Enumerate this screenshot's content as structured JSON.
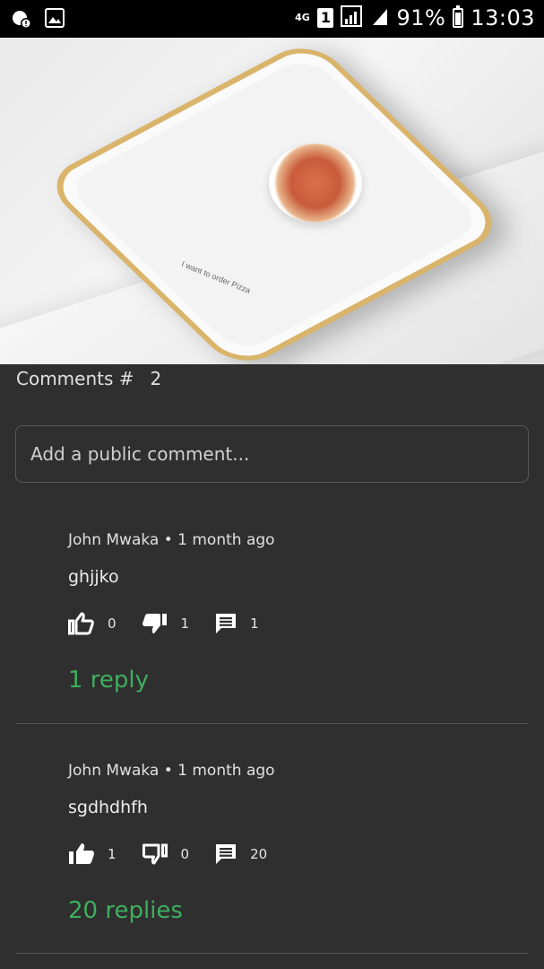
{
  "status_bar": {
    "network": "4G",
    "sim": "1",
    "battery": "91%",
    "battery_level": 0.91,
    "time": "13:03"
  },
  "hero": {
    "phone_screen_text": "I want to order Pizza"
  },
  "comments": {
    "header_label": "Comments #",
    "count": "2",
    "add_placeholder": "Add a public comment..."
  },
  "items": [
    {
      "author_line": "John Mwaka • 1 month ago",
      "text": "ghjjko",
      "likes": "0",
      "dislikes": "1",
      "replies_count": "1",
      "replies_link": "1 reply",
      "liked": false,
      "disliked": true
    },
    {
      "author_line": "John Mwaka • 1 month ago",
      "text": "sgdhdhfh",
      "likes": "1",
      "dislikes": "0",
      "replies_count": "20",
      "replies_link": "20 replies",
      "liked": true,
      "disliked": false
    }
  ],
  "colors": {
    "background": "#2f2f2f",
    "reply_link": "#3fae5e",
    "status_bar": "#000000"
  }
}
